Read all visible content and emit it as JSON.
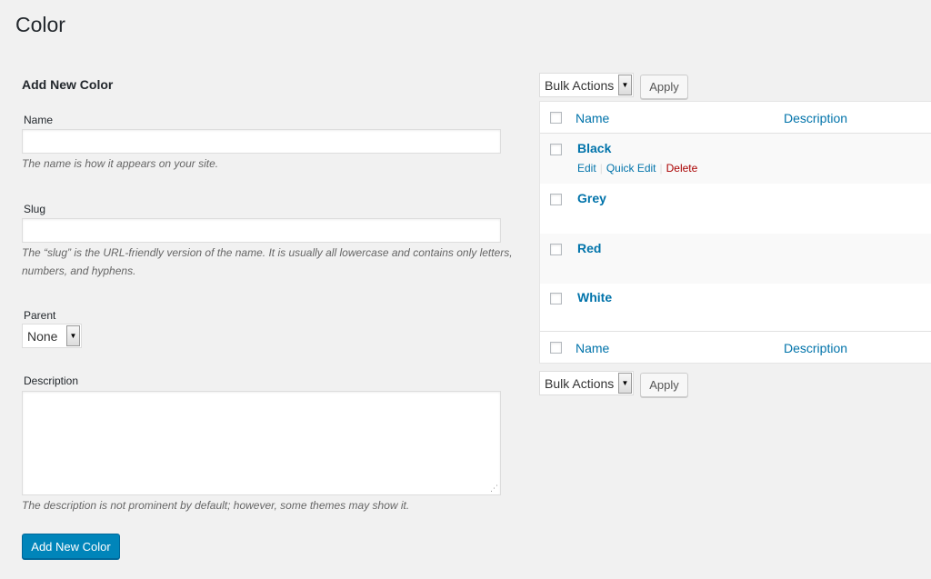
{
  "page": {
    "title": "Color"
  },
  "form": {
    "heading": "Add New Color",
    "name_label": "Name",
    "name_value": "",
    "name_help": "The name is how it appears on your site.",
    "slug_label": "Slug",
    "slug_value": "",
    "slug_help": "The “slug” is the URL-friendly version of the name. It is usually all lowercase and contains only letters, numbers, and hyphens.",
    "parent_label": "Parent",
    "parent_value": "None",
    "description_label": "Description",
    "description_value": "",
    "description_help": "The description is not prominent by default; however, some themes may show it.",
    "submit_label": "Add New Color"
  },
  "list": {
    "bulk_actions_label": "Bulk Actions",
    "apply_label": "Apply",
    "columns": {
      "name": "Name",
      "description": "Description"
    },
    "rows": [
      {
        "name": "Black",
        "description": ""
      },
      {
        "name": "Grey",
        "description": ""
      },
      {
        "name": "Red",
        "description": ""
      },
      {
        "name": "White",
        "description": ""
      }
    ],
    "row_actions": {
      "edit": "Edit",
      "quick_edit": "Quick Edit",
      "delete": "Delete",
      "separator": "|"
    }
  },
  "colors": {
    "primary": "#0085ba",
    "link": "#0073aa",
    "delete": "#aa0000",
    "background": "#f1f1f1"
  },
  "icons": {
    "dropdown": "chevron-down-icon",
    "resize": "resize-grip-icon"
  }
}
